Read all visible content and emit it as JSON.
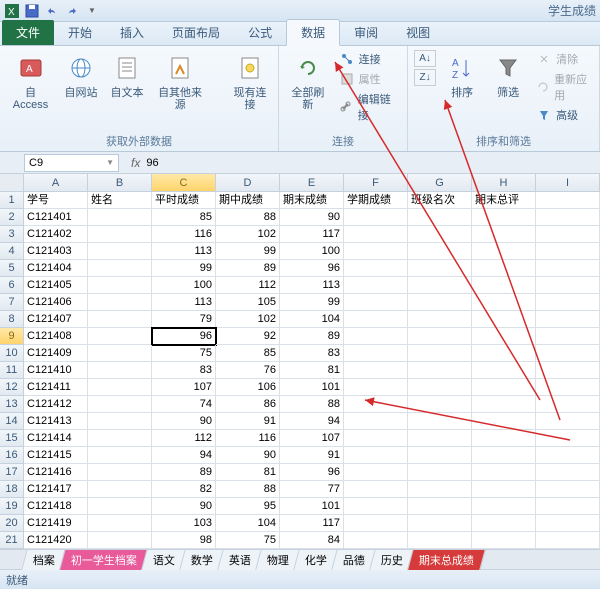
{
  "titlebar": {
    "doc_title": "学生成绩"
  },
  "tabs": {
    "file": "文件",
    "home": "开始",
    "insert": "插入",
    "layout": "页面布局",
    "formula": "公式",
    "data": "数据",
    "review": "审阅",
    "view": "视图"
  },
  "ribbon": {
    "ext": {
      "access": "自 Access",
      "web": "自网站",
      "text": "自文本",
      "other": "自其他来源",
      "existing": "现有连接",
      "label": "获取外部数据"
    },
    "conn": {
      "refresh": "全部刷新",
      "connections": "连接",
      "properties": "属性",
      "editlinks": "编辑链接",
      "label": "连接"
    },
    "sort": {
      "az": "A↓Z",
      "za": "Z↓A",
      "sort": "排序",
      "filter": "筛选",
      "clear": "清除",
      "reapply": "重新应用",
      "advanced": "高级",
      "label": "排序和筛选"
    }
  },
  "namebox": {
    "ref": "C9",
    "fx": "fx",
    "formula": "96"
  },
  "columns": [
    "A",
    "B",
    "C",
    "D",
    "E",
    "F",
    "G",
    "H",
    "I"
  ],
  "headers": [
    "学号",
    "姓名",
    "平时成绩",
    "期中成绩",
    "期末成绩",
    "学期成绩",
    "班级名次",
    "期末总评"
  ],
  "data": [
    [
      "C121401",
      "",
      "85",
      "88",
      "90"
    ],
    [
      "C121402",
      "",
      "116",
      "102",
      "117"
    ],
    [
      "C121403",
      "",
      "113",
      "99",
      "100"
    ],
    [
      "C121404",
      "",
      "99",
      "89",
      "96"
    ],
    [
      "C121405",
      "",
      "100",
      "112",
      "113"
    ],
    [
      "C121406",
      "",
      "113",
      "105",
      "99"
    ],
    [
      "C121407",
      "",
      "79",
      "102",
      "104"
    ],
    [
      "C121408",
      "",
      "96",
      "92",
      "89"
    ],
    [
      "C121409",
      "",
      "75",
      "85",
      "83"
    ],
    [
      "C121410",
      "",
      "83",
      "76",
      "81"
    ],
    [
      "C121411",
      "",
      "107",
      "106",
      "101"
    ],
    [
      "C121412",
      "",
      "74",
      "86",
      "88"
    ],
    [
      "C121413",
      "",
      "90",
      "91",
      "94"
    ],
    [
      "C121414",
      "",
      "112",
      "116",
      "107"
    ],
    [
      "C121415",
      "",
      "94",
      "90",
      "91"
    ],
    [
      "C121416",
      "",
      "89",
      "81",
      "96"
    ],
    [
      "C121417",
      "",
      "82",
      "88",
      "77"
    ],
    [
      "C121418",
      "",
      "90",
      "95",
      "101"
    ],
    [
      "C121419",
      "",
      "103",
      "104",
      "117"
    ],
    [
      "C121420",
      "",
      "98",
      "75",
      "84"
    ]
  ],
  "activeCell": {
    "row": 9,
    "col": 2
  },
  "sheets": [
    "档案",
    "初一学生档案",
    "语文",
    "数学",
    "英语",
    "物理",
    "化学",
    "品德",
    "历史",
    "期末总成绩"
  ],
  "status": {
    "ready": "就绪"
  }
}
